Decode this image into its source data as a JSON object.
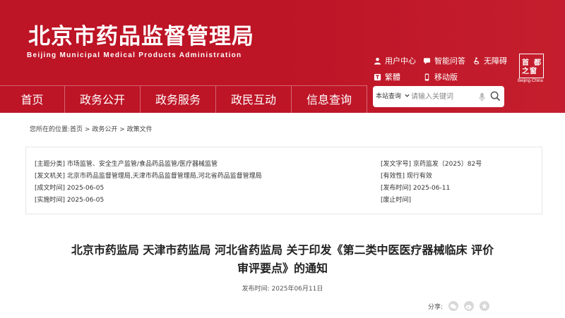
{
  "site": {
    "title": "北京市药品监督管理局",
    "subtitle": "Beijing Municipal Medical Products Administration",
    "seal_chars": [
      "首",
      "都",
      "之",
      "窗"
    ],
    "seal_caption": "Beijing·China"
  },
  "tools": [
    {
      "label": "用户中心",
      "icon": "user-icon"
    },
    {
      "label": "智能问答",
      "icon": "chat-icon"
    },
    {
      "label": "无障碍",
      "icon": "accessibility-icon"
    },
    {
      "label": "繁體",
      "icon": "traditional-chinese-icon"
    },
    {
      "label": "移动版",
      "icon": "mobile-icon"
    }
  ],
  "nav": [
    "首页",
    "政务公开",
    "政务服务",
    "政民互动",
    "信息查询"
  ],
  "search": {
    "scope": "本站查询",
    "placeholder": "请输入关键词"
  },
  "breadcrumb": {
    "prefix": "您所在的位置:",
    "items": [
      "首页",
      "政务公开",
      "政策文件"
    ],
    "sep": " > "
  },
  "meta": {
    "left": [
      {
        "k": "[主题分类]",
        "v": "市场监管、安全生产监管/食品药品监管/医疗器械监管"
      },
      {
        "k": "[发文机关]",
        "v": "北京市药品监督管理局,天津市药品监督管理局,河北省药品监督管理局"
      },
      {
        "k": "[成文时间]",
        "v": "2025-06-05"
      },
      {
        "k": "[实施时间]",
        "v": "2025-06-05"
      }
    ],
    "right": [
      {
        "k": "[发文字号]",
        "v": "京药监发〔2025〕82号"
      },
      {
        "k": "[有效性]",
        "v": "现行有效"
      },
      {
        "k": "[发布时间]",
        "v": "2025-06-11"
      },
      {
        "k": "[废止时间]",
        "v": ""
      }
    ]
  },
  "article": {
    "title_line1": "北京市药监局 天津市药监局 河北省药监局 关于印发《第二类中医医疗器械临床 评价",
    "title_line2": "审评要点》的通知",
    "pub_label": "发布时间:",
    "pub_date": "2025年06月11日",
    "share_label": "分享:"
  },
  "colors": {
    "brand": "#bd1426"
  }
}
